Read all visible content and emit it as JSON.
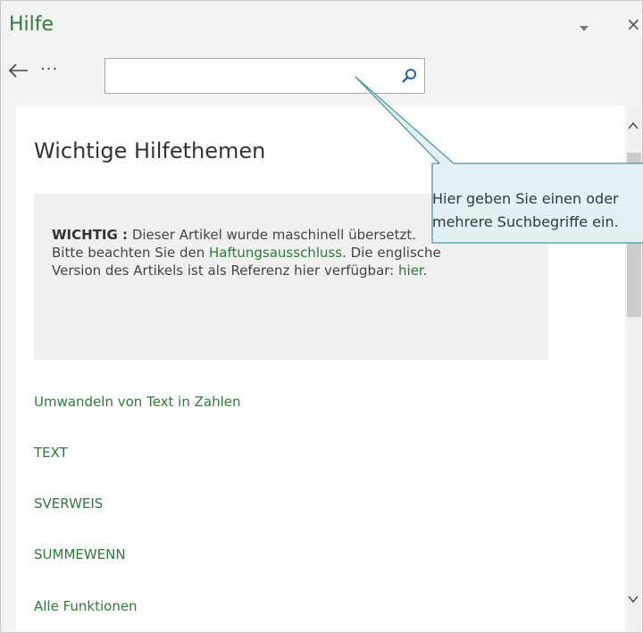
{
  "pane": {
    "title": "Hilfe",
    "menu_icon": "dropdown-arrow-icon",
    "close_glyph": "×"
  },
  "toolbar": {
    "back_icon": "back-arrow-icon",
    "more_label": "···",
    "search": {
      "value": "",
      "placeholder": ""
    },
    "search_icon": "magnifier-icon"
  },
  "content": {
    "heading": "Wichtige Hilfethemen",
    "notice": {
      "label": "WICHTIG :",
      "text_1": " Dieser Artikel wurde maschinell übersetzt.",
      "text_2": "Bitte beachten Sie den ",
      "disclaimer_link": "Haftungsausschluss",
      "text_3": ". Die englische Version des Artikels ist als Referenz hier verfügbar: ",
      "here_link": "hier",
      "text_4": "."
    },
    "topics": [
      "Umwandeln von Text in Zahlen",
      "TEXT",
      "SVERWEIS",
      "SUMMEWENN",
      "Alle Funktionen"
    ]
  },
  "callout": {
    "line_1": "Hier geben Sie einen oder",
    "line_2": "mehrere Suchbegriffe ein."
  },
  "colors": {
    "accent": "#2f7a3b",
    "callout_fill": "#e3f1f2",
    "callout_border": "#4a9aa3"
  }
}
